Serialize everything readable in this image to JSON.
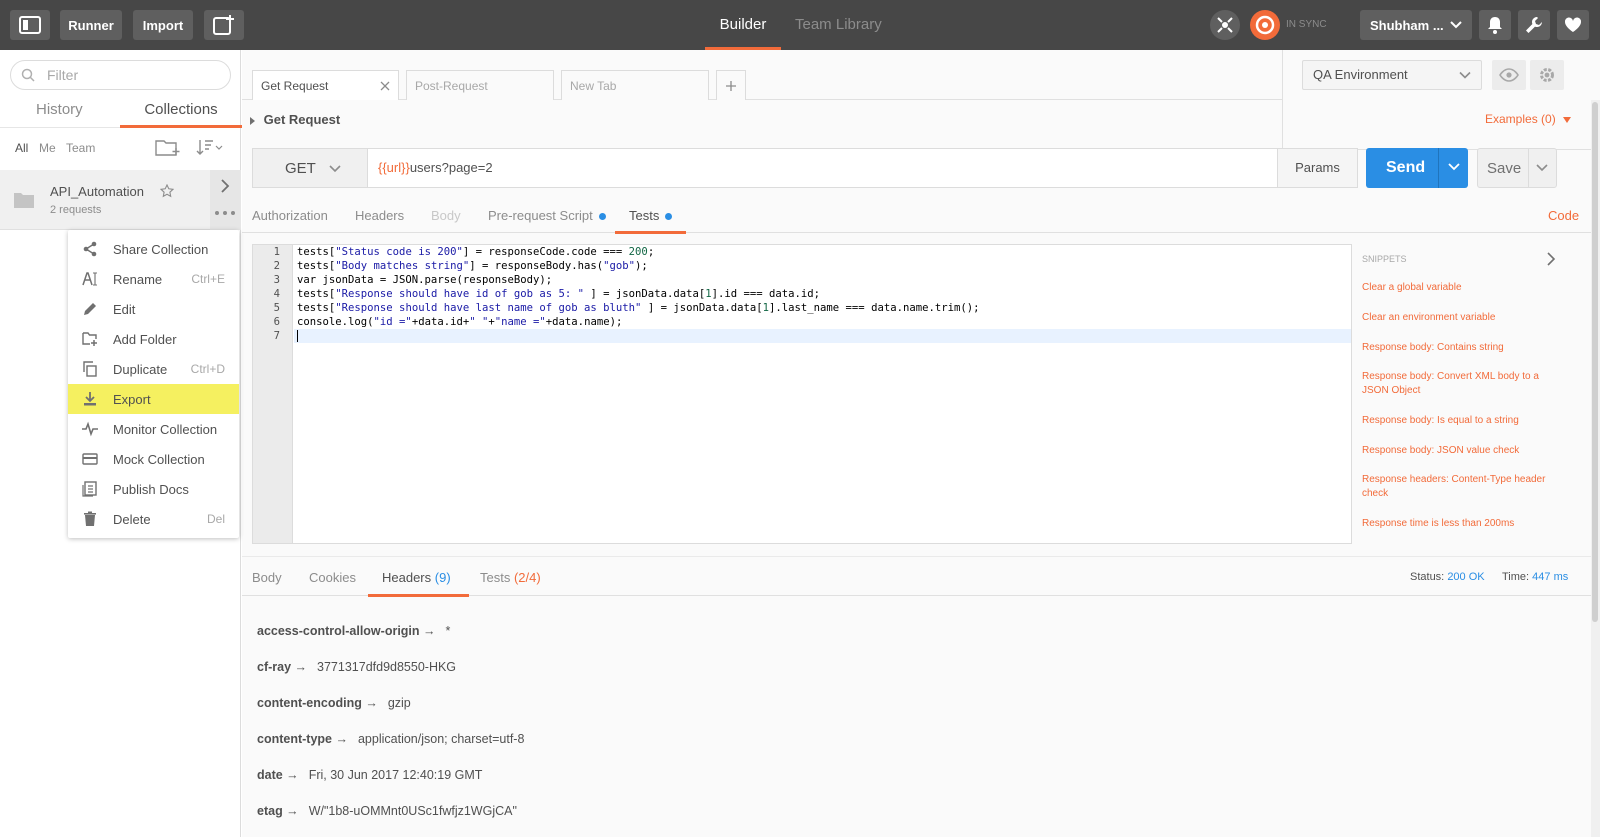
{
  "header": {
    "runner_label": "Runner",
    "import_label": "Import",
    "tabs": [
      {
        "label": "Builder",
        "active": true
      },
      {
        "label": "Team Library",
        "active": false
      }
    ],
    "sync_label": "IN SYNC",
    "user_label": "Shubham ...",
    "sync_color": "#f26b3a"
  },
  "sidebar": {
    "filter_placeholder": "Filter",
    "tabs": [
      {
        "label": "History",
        "active": false
      },
      {
        "label": "Collections",
        "active": true
      }
    ],
    "scopes": [
      "All",
      "Me",
      "Team"
    ],
    "collection": {
      "name": "API_Automation",
      "count": "2 requests"
    }
  },
  "context_menu": {
    "items": [
      {
        "label": "Share Collection",
        "shortcut": "",
        "icon": "share-icon"
      },
      {
        "label": "Rename",
        "shortcut": "Ctrl+E",
        "icon": "rename-icon"
      },
      {
        "label": "Edit",
        "shortcut": "",
        "icon": "pencil-icon"
      },
      {
        "label": "Add Folder",
        "shortcut": "",
        "icon": "add-folder-icon"
      },
      {
        "label": "Duplicate",
        "shortcut": "Ctrl+D",
        "icon": "duplicate-icon"
      },
      {
        "label": "Export",
        "shortcut": "",
        "icon": "download-icon",
        "highlighted": true
      },
      {
        "label": "Monitor Collection",
        "shortcut": "",
        "icon": "pulse-icon"
      },
      {
        "label": "Mock Collection",
        "shortcut": "",
        "icon": "server-icon"
      },
      {
        "label": "Publish Docs",
        "shortcut": "",
        "icon": "docs-icon"
      },
      {
        "label": "Delete",
        "shortcut": "Del",
        "icon": "trash-icon"
      }
    ]
  },
  "request_tabs": [
    {
      "label": "Get Request",
      "active": true
    },
    {
      "label": "Post-Request",
      "active": false
    },
    {
      "label": "New Tab",
      "active": false
    }
  ],
  "environment": {
    "selected": "QA Environment"
  },
  "request": {
    "name": "Get Request",
    "examples_label": "Examples (0)",
    "method": "GET",
    "url_var": "{{url}}",
    "url_rest": "users?page=2",
    "params_label": "Params",
    "send_label": "Send",
    "save_label": "Save"
  },
  "sub_tabs": [
    {
      "label": "Authorization",
      "active": false,
      "dot": false
    },
    {
      "label": "Headers",
      "active": false,
      "dot": false
    },
    {
      "label": "Body",
      "active": false,
      "dot": false,
      "disabled": true
    },
    {
      "label": "Pre-request Script",
      "active": false,
      "dot": true
    },
    {
      "label": "Tests",
      "active": true,
      "dot": true
    }
  ],
  "code_link": "Code",
  "editor": {
    "line_numbers": [
      "1",
      "2",
      "3",
      "4",
      "5",
      "6",
      "7"
    ],
    "lines": [
      [
        "tests[",
        "\"Status code is 200\"",
        "] = responseCode.code === ",
        "200",
        ";"
      ],
      [
        "tests[",
        "\"Body matches string\"",
        "] = responseBody.has(",
        "\"gob\"",
        ");"
      ],
      [
        "var jsonData = JSON.parse(responseBody);"
      ],
      [
        "tests[",
        "\"Response should have id of gob as 5: \"",
        " ] = jsonData.data[",
        "1",
        "].id === data.id;"
      ],
      [
        "tests[",
        "\"Response should have last name of gob as bluth\"",
        " ] = jsonData.data[",
        "1",
        "].last_name === data.name.trim();"
      ],
      [
        "console.log(",
        "\"id =\"",
        "+data.id+",
        "\" \"",
        "+",
        "\"name =\"",
        "+data.name);"
      ],
      [
        ""
      ]
    ]
  },
  "snippets": {
    "title": "SNIPPETS",
    "items": [
      "Clear a global variable",
      "Clear an environment variable",
      "Response body: Contains string",
      "Response body: Convert XML body to a JSON Object",
      "Response body: Is equal to a string",
      "Response body: JSON value check",
      "Response headers: Content-Type header check",
      "Response time is less than 200ms"
    ]
  },
  "response": {
    "tabs": [
      {
        "label": "Body",
        "count": "",
        "active": false
      },
      {
        "label": "Cookies",
        "count": "",
        "active": false
      },
      {
        "label": "Headers",
        "count": "(9)",
        "active": true
      },
      {
        "label": "Tests",
        "count": "(2/4)",
        "active": false
      }
    ],
    "status_label": "Status:",
    "status_value": "200 OK",
    "time_label": "Time:",
    "time_value": "447 ms",
    "headers": [
      {
        "key": "access-control-allow-origin →",
        "value": "*"
      },
      {
        "key": "cf-ray →",
        "value": "3771317dfd9d8550-HKG"
      },
      {
        "key": "content-encoding →",
        "value": "gzip"
      },
      {
        "key": "content-type →",
        "value": "application/json; charset=utf-8"
      },
      {
        "key": "date →",
        "value": "Fri, 30 Jun 2017 12:40:19 GMT"
      },
      {
        "key": "etag →",
        "value": "W/\"1b8-uOMMnt0USc1fwfjz1WGjCA\""
      }
    ]
  }
}
